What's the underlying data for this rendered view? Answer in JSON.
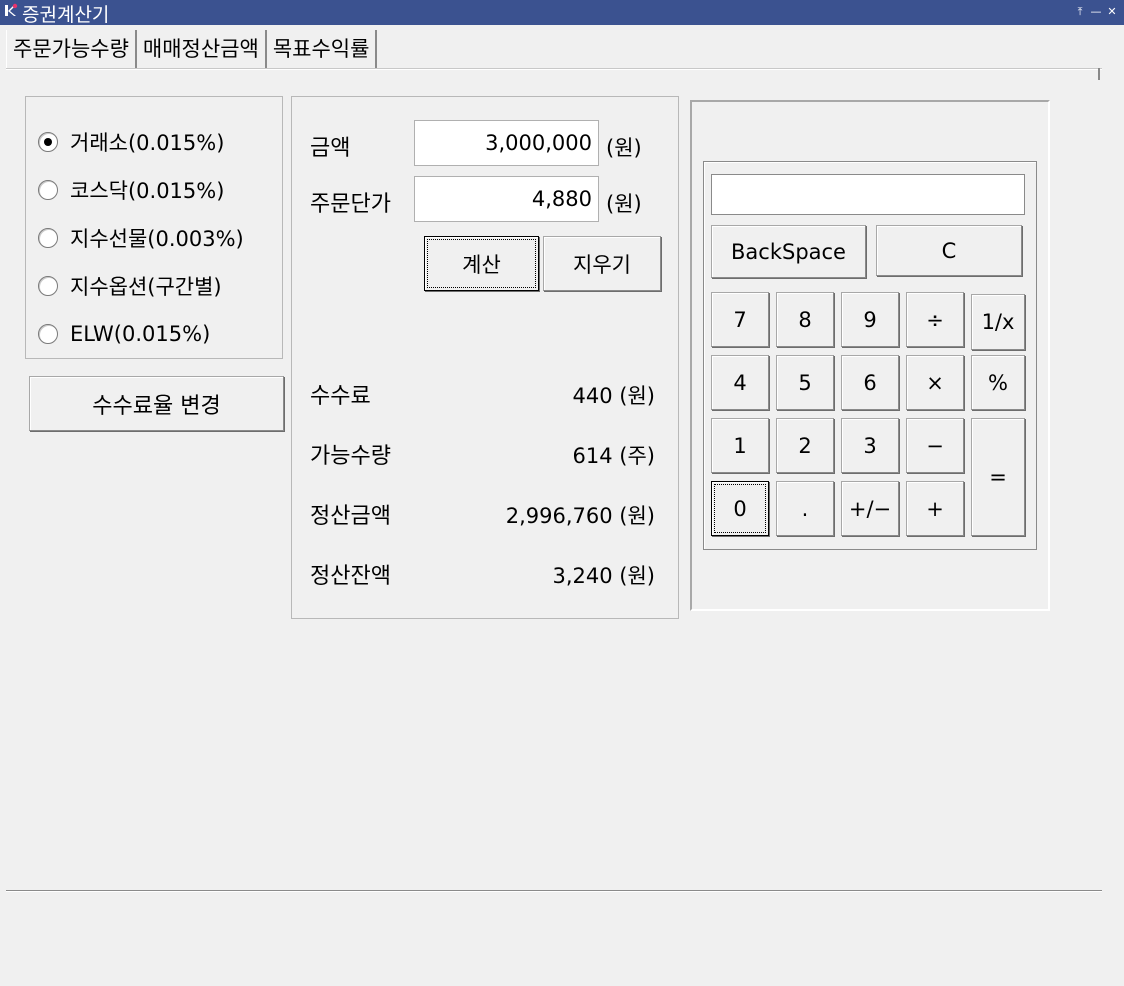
{
  "window": {
    "title": "증권계산기",
    "controls": [
      "⤒",
      "—",
      "✕"
    ]
  },
  "tabs": [
    {
      "label": "주문가능수량",
      "active": true
    },
    {
      "label": "매매정산금액",
      "active": false
    },
    {
      "label": "목표수익률",
      "active": false
    }
  ],
  "market": {
    "options": [
      {
        "label": "거래소(0.015%)",
        "checked": true
      },
      {
        "label": "코스닥(0.015%)",
        "checked": false
      },
      {
        "label": "지수선물(0.003%)",
        "checked": false
      },
      {
        "label": "지수옵션(구간별)",
        "checked": false
      },
      {
        "label": "ELW(0.015%)",
        "checked": false
      }
    ],
    "change_fee_label": "수수료율 변경"
  },
  "form": {
    "amount_label": "금액",
    "amount_value": "3,000,000",
    "amount_unit": "(원)",
    "price_label": "주문단가",
    "price_value": "4,880",
    "price_unit": "(원)",
    "calc_button": "계산",
    "clear_button": "지우기"
  },
  "results": [
    {
      "label": "수수료",
      "value": "440 (원)"
    },
    {
      "label": "가능수량",
      "value": "614 (주)"
    },
    {
      "label": "정산금액",
      "value": "2,996,760 (원)"
    },
    {
      "label": "정산잔액",
      "value": "3,240 (원)"
    }
  ],
  "calculator": {
    "display": "",
    "backspace_label": "BackSpace",
    "clear_label": "C",
    "keys": {
      "k7": "7",
      "k8": "8",
      "k9": "9",
      "div": "÷",
      "recip": "1/x",
      "k4": "4",
      "k5": "5",
      "k6": "6",
      "mul": "×",
      "pct": "%",
      "k1": "1",
      "k2": "2",
      "k3": "3",
      "sub": "−",
      "eq": "=",
      "k0": "0",
      "dot": ".",
      "neg": "+/−",
      "add": "+"
    }
  },
  "colors": {
    "titlebar": "#3b5290",
    "window_bg": "#f0f0f0"
  }
}
